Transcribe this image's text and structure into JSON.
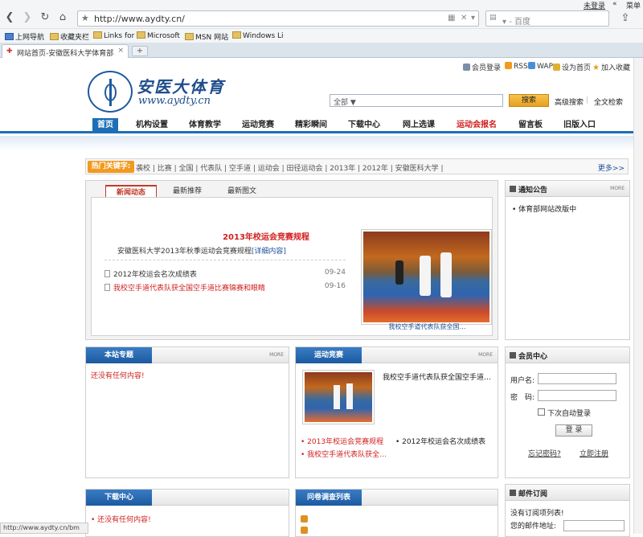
{
  "browser": {
    "url": "http://www.aydty.cn/",
    "search_placeholder": "百度",
    "login": "未登录",
    "menu": "菜单",
    "favorites": [
      "上网导航",
      "收藏夹栏",
      "Links for",
      "Microsoft",
      "MSN 网站",
      "Windows Li"
    ],
    "tab_title": "网站首页-安徽医科大学体育部",
    "status_url": "http://www.aydty.cn/bm"
  },
  "header": {
    "logo_title": "安医大体育",
    "logo_url": "www.aydty.cn",
    "links": [
      "会员登录",
      "RSS",
      "WAP",
      "设为首页",
      "加入收藏"
    ],
    "search_select": "全部",
    "search_button": "搜索",
    "advanced_search": "高级搜索",
    "fulltext_search": "全文检索"
  },
  "nav": {
    "items": [
      "首页",
      "机构设置",
      "体育教学",
      "运动竞赛",
      "精彩瞬间",
      "下载中心",
      "网上选课",
      "运动会报名",
      "留言板",
      "旧版入口"
    ]
  },
  "hotwords": {
    "label": "热门关键字:",
    "words": "袭校 | 比赛 | 全国 | 代表队 | 空手道 | 运动会 | 田径运动会 | 2013年 | 2012年 | 安徽医科大学 |",
    "more": "更多>>"
  },
  "news": {
    "tabs": [
      "新闻动态",
      "最新推荐",
      "最新图文"
    ],
    "headline": "2013年校运会竞赛规程",
    "summary": "安徽医科大学2013年秋季运动会竞赛规程",
    "summary_more": "[详细内容]",
    "items": [
      {
        "title": "2012年校运会名次成绩表",
        "date": "09-24"
      },
      {
        "title": "我校空手道代表队获全国空手道比赛锦赛和眼睛",
        "date": "09-16"
      }
    ],
    "photo_caption": "我校空手道代表队获全国…"
  },
  "notice": {
    "title": "通知公告",
    "more": "MORE",
    "items": [
      "体育部网站改版中"
    ]
  },
  "special": {
    "title": "本站专题",
    "more": "MORE",
    "empty": "还没有任何内容!"
  },
  "competition": {
    "title": "运动竞赛",
    "more": "MORE",
    "photo_title": "我校空手道代表队获全国空手道…",
    "links": [
      "2013年校运会竞赛规程",
      "2012年校运会名次成绩表",
      "我校空手道代表队获全…"
    ]
  },
  "member": {
    "title": "会员中心",
    "username_label": "用户名:",
    "password_label": "密　码:",
    "auto_login": "下次自动登录",
    "login_button": "登 录",
    "forgot": "忘记密码?",
    "register": "立即注册"
  },
  "download": {
    "title": "下载中心",
    "empty": "还没有任何内容!"
  },
  "survey": {
    "title": "问卷调查列表"
  },
  "subscribe": {
    "title": "邮件订阅",
    "text1": "没有订阅项列表!",
    "text2": "您的邮件地址:"
  }
}
